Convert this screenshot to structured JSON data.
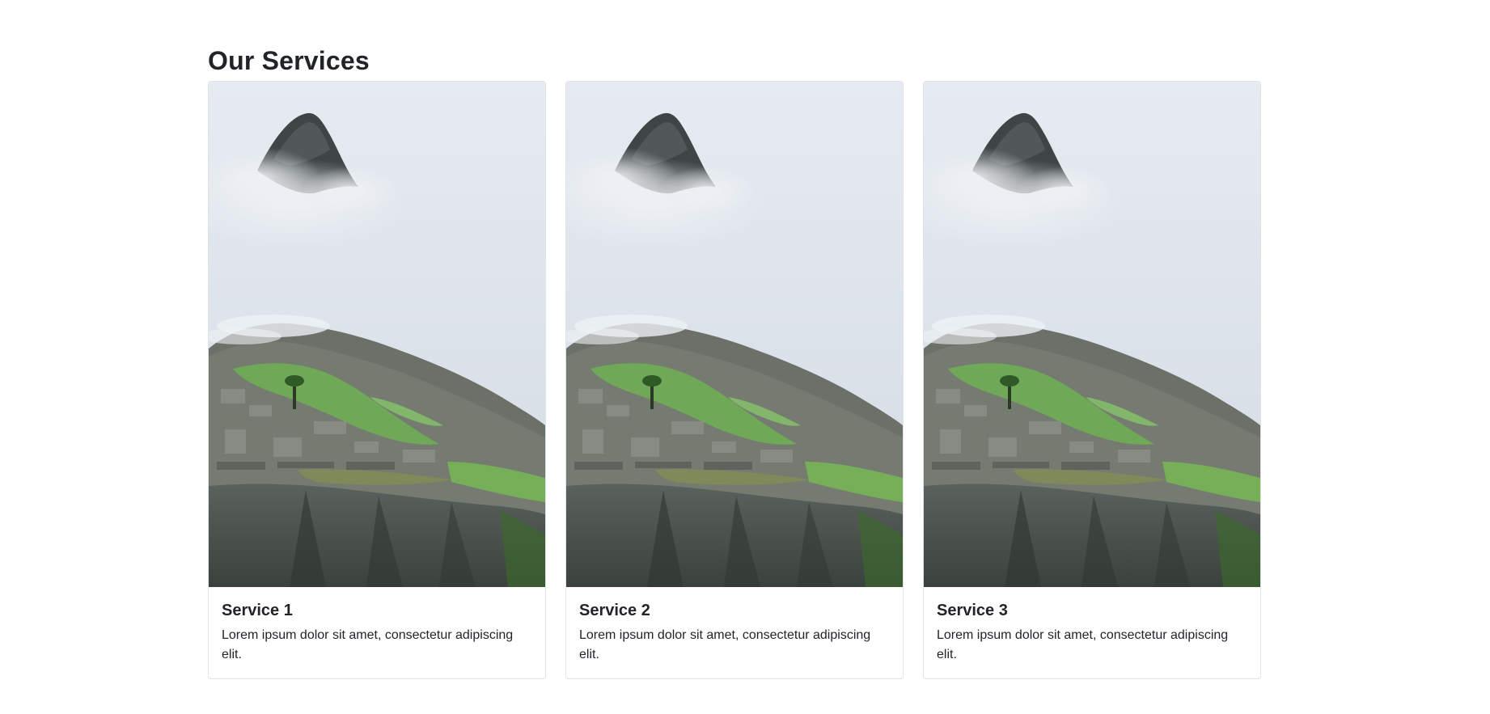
{
  "section": {
    "title": "Our Services"
  },
  "cards": [
    {
      "title": "Service 1",
      "text": "Lorem ipsum dolor sit amet, consectetur adipiscing elit."
    },
    {
      "title": "Service 2",
      "text": "Lorem ipsum dolor sit amet, consectetur adipiscing elit."
    },
    {
      "title": "Service 3",
      "text": "Lorem ipsum dolor sit amet, consectetur adipiscing elit."
    }
  ],
  "colors": {
    "text": "#212529",
    "card_border": "#dfe2e6",
    "sky": "#dfe5ec",
    "grass": "#6aa84a",
    "rock": "#5f6660"
  }
}
